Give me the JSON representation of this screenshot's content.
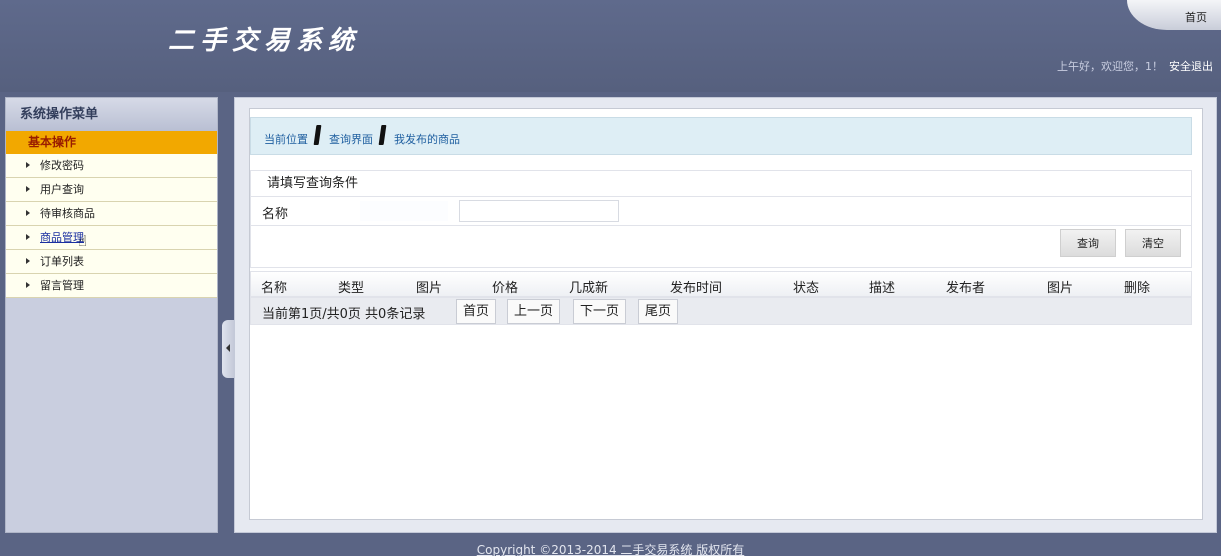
{
  "header": {
    "system_name": "二手交易系统",
    "home_link": "首页",
    "greeting": "上午好，欢迎您，1！",
    "logout": "安全退出"
  },
  "sidebar": {
    "title": "系统操作菜单",
    "group": "基本操作",
    "items": [
      {
        "label": "修改密码"
      },
      {
        "label": "用户查询"
      },
      {
        "label": "待审核商品"
      },
      {
        "label": "商品管理"
      },
      {
        "label": "订单列表"
      },
      {
        "label": "留言管理"
      }
    ],
    "active_index": 3
  },
  "breadcrumb": [
    "当前位置",
    "查询界面",
    "我发布的商品"
  ],
  "query": {
    "title": "请填写查询条件",
    "name_label": "名称",
    "name_value": "",
    "query_button": "查询",
    "clear_button": "清空"
  },
  "table": {
    "columns": [
      "名称",
      "类型",
      "图片",
      "价格",
      "几成新",
      "发布时间",
      "状态",
      "描述",
      "发布者",
      "图片",
      "删除"
    ],
    "rows": []
  },
  "pager": {
    "info": "当前第1页/共0页  共0条记录",
    "first": "首页",
    "prev": "上一页",
    "next": "下一页",
    "last": "尾页"
  },
  "footer": {
    "copyright": "Copyright ©2013-2014 二手交易系统 版权所有"
  },
  "colors": {
    "header_bg": "#5a6484",
    "menu_group_bg": "#f2a800",
    "breadcrumb_bg": "#deeef5"
  }
}
